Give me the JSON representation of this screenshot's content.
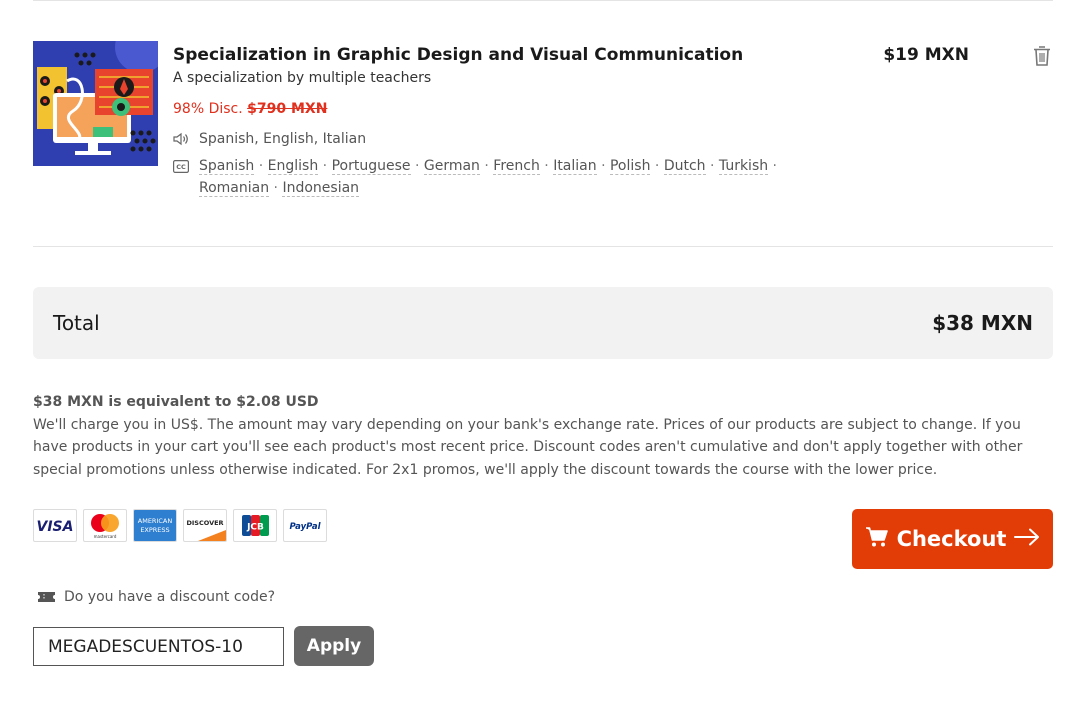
{
  "cart_item": {
    "title": "Specialization in Graphic Design and Visual Communication",
    "subtitle": "A specialization by multiple teachers",
    "discount_label": "98% Disc.",
    "original_price": "$790 MXN",
    "audio_languages": "Spanish, English, Italian",
    "subtitle_languages": [
      "Spanish",
      "English",
      "Portuguese",
      "German",
      "French",
      "Italian",
      "Polish",
      "Dutch",
      "Turkish",
      "Romanian",
      "Indonesian"
    ],
    "price": "$19 MXN",
    "icons": {
      "audio": "speaker-icon",
      "subtitles": "cc-icon",
      "remove": "trash-icon"
    }
  },
  "total": {
    "label": "Total",
    "value": "$38 MXN"
  },
  "note": {
    "equivalence": "$38 MXN is equivalent to $2.08 USD",
    "text": "We'll charge you in US$. The amount may vary depending on your bank's exchange rate. Prices of our products are subject to change. If you have products in your cart you'll see each product's most recent price. Discount codes aren't cumulative and don't apply together with other special promotions unless otherwise indicated. For 2x1 promos, we'll apply the discount towards the course with the lower price."
  },
  "payment_methods": {
    "visa": "VISA",
    "mastercard": "mastercard",
    "amex_line1": "AMERICAN",
    "amex_line2": "EXPRESS",
    "discover": "DISCOVER",
    "jcb": "JCB",
    "paypal": "PayPal"
  },
  "checkout": {
    "label": "Checkout",
    "color": "#e23d07"
  },
  "discount": {
    "question": "Do you have a discount code?",
    "code_value": "MEGADESCUENTOS-10",
    "apply_label": "Apply"
  },
  "colors": {
    "discount_red": "#e0301e",
    "total_bg": "#f2f2f2",
    "apply_bg": "#666666"
  }
}
